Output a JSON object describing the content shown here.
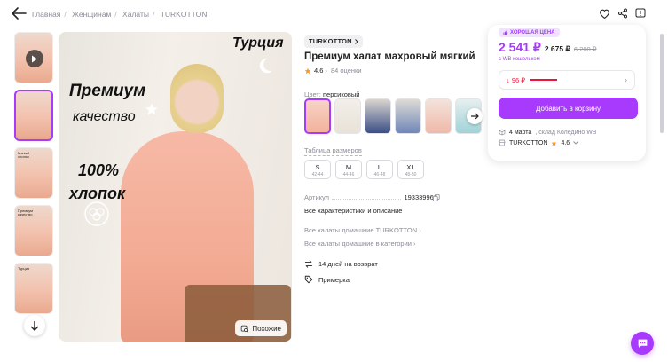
{
  "breadcrumbs": [
    "Главная",
    "Женщинам",
    "Халаты",
    "TURKOTTON"
  ],
  "thumbs": {
    "t3_text": "Мягкий\nхлопок",
    "t4_text": "Премиум\nкачество",
    "t5_text": "Турция"
  },
  "main_image": {
    "promo_1": "Премиум",
    "promo_2": "качество",
    "promo_3": "100%",
    "promo_4": "хлопок",
    "promo_5": "Турция",
    "similar_label": "Похожие"
  },
  "product": {
    "brand": "TURKOTTON",
    "title": "Премиум халат махровый мягкий",
    "rating": "4.6",
    "reviews": "84 оценки",
    "color_label": "Цвет:",
    "color_value": "персиковый",
    "swatch_colors": [
      "#f3b29c",
      "#e9e2d8",
      "#3b4f86",
      "#6f86b8",
      "#f0b8a8",
      "#9fd3d8"
    ],
    "size_table_label": "Таблица размеров",
    "sizes": [
      {
        "size": "S",
        "range": "42-44"
      },
      {
        "size": "M",
        "range": "44-46"
      },
      {
        "size": "L",
        "range": "46-48"
      },
      {
        "size": "XL",
        "range": "48-50"
      }
    ],
    "article_label": "Артикул",
    "article_value": "193339960",
    "all_specs": "Все характеристики и описание",
    "link_brand": "Все халаты домашние TURKOTTON",
    "link_category": "Все халаты домашние в категории",
    "return_text": "14 дней на возврат",
    "fitting_text": "Примерка"
  },
  "buybox": {
    "good_price_badge": "ХОРОШАЯ ЦЕНА",
    "price_wallet": "2 541 ₽",
    "price_regular": "2 675 ₽",
    "price_old": "6 200 ₽",
    "wallet_note": "с WB кошельком",
    "discount_text": "↓ 96 ₽",
    "cart_button": "Добавить в корзину",
    "delivery_date": "4 марта",
    "delivery_warehouse": ", склад Коледино WB",
    "seller_name": "TURKOTTON",
    "seller_rating": "4.6"
  },
  "colors": {
    "accent": "#a73afd",
    "discount_red": "#f0143c",
    "muted_text": "#8b8b98"
  }
}
